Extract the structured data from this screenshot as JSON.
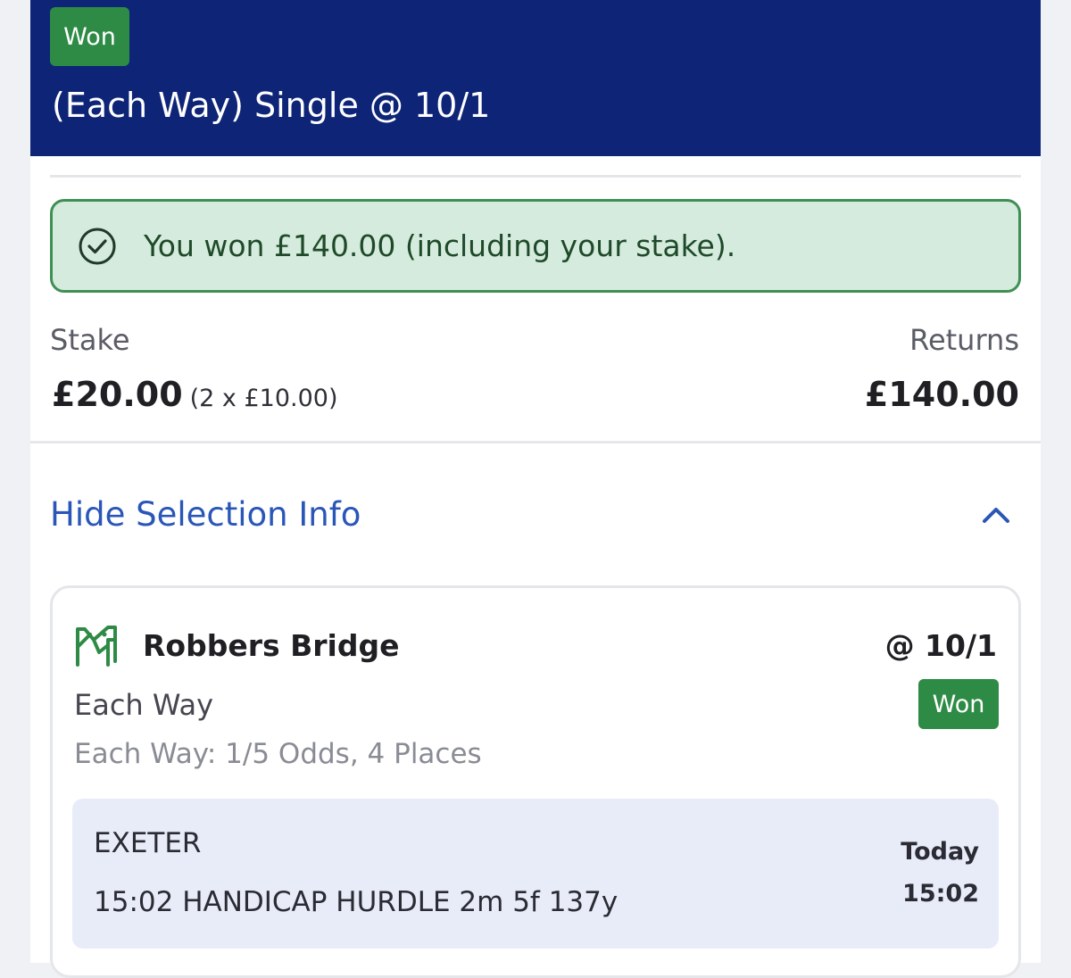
{
  "header": {
    "status_badge": "Won",
    "title": "(Each Way) Single @ 10/1"
  },
  "result_banner": {
    "icon": "check-circle-icon",
    "text": "You won £140.00 (including your stake)."
  },
  "summary": {
    "stake_label": "Stake",
    "stake_value": "£20.00",
    "stake_breakdown": "(2 x £10.00)",
    "returns_label": "Returns",
    "returns_value": "£140.00"
  },
  "selection_toggle": {
    "label": "Hide Selection Info",
    "icon": "chevron-up-icon"
  },
  "selection": {
    "icon": "horse-racing-icon",
    "name": "Robbers Bridge",
    "odds": "@ 10/1",
    "status_badge": "Won",
    "market": "Each Way",
    "terms": "Each Way: 1/5 Odds, 4 Places",
    "race": {
      "venue": "EXETER",
      "name": "15:02 HANDICAP HURDLE 2m 5f 137y",
      "day": "Today",
      "time": "15:02"
    }
  },
  "colors": {
    "header_bg": "#0e2477",
    "won_green": "#2e8b45",
    "banner_bg": "#d5ebdd",
    "link_blue": "#2a56b8"
  }
}
